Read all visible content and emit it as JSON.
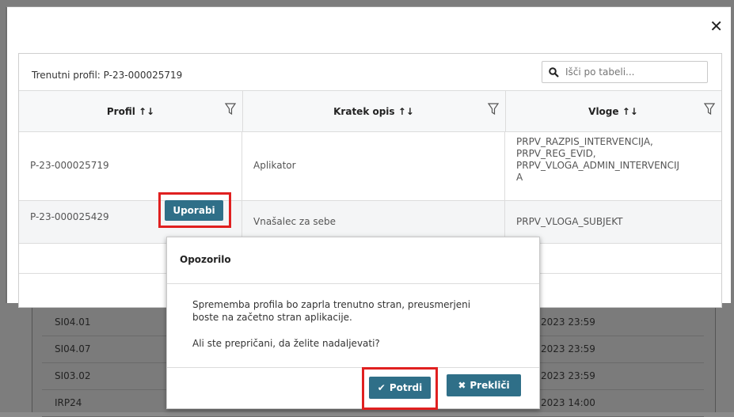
{
  "modal": {
    "current_profile": "Trenutni profil: P-23-000025719",
    "search_placeholder": "Išči po tabeli...",
    "columns": [
      "Profil ↑↓",
      "Kratek opis ↑↓",
      "Vloge ↑↓"
    ],
    "rows": [
      {
        "profil": "P-23-000025719",
        "opis": "Aplikator",
        "vloge": [
          "PRPV_RAZPIS_INTERVENCIJA,",
          "PRPV_REG_EVID,",
          "PRPV_VLOGA_ADMIN_INTERVENCIJ",
          "A"
        ]
      },
      {
        "profil": "P-23-000025429",
        "opis": "Vnašalec za sebe",
        "vloge": [
          "PRPV_VLOGA_SUBJEKT"
        ],
        "action": "Uporabi"
      }
    ]
  },
  "background": {
    "rows": [
      {
        "code": "SI04.01",
        "c2": "",
        "c3": "2023 23:59"
      },
      {
        "code": "SI04.07",
        "c2": "",
        "c3": "2023 23:59"
      },
      {
        "code": "SI03.02",
        "c2": "",
        "c3": "2023 23:59"
      },
      {
        "code": "IRP24",
        "c2": "",
        "c3": "2023 14:00"
      }
    ]
  },
  "dialog": {
    "title": "Opozorilo",
    "line1": "Sprememba profila bo zaprla trenutno stran, preusmerjeni",
    "line2": "boste na začetno stran aplikacije.",
    "line3": "Ali ste prepričani, da želite nadaljevati?",
    "confirm": "Potrdi",
    "cancel": "Prekliči"
  },
  "colors": {
    "button": "#2f6f88",
    "highlight": "#e02020"
  }
}
